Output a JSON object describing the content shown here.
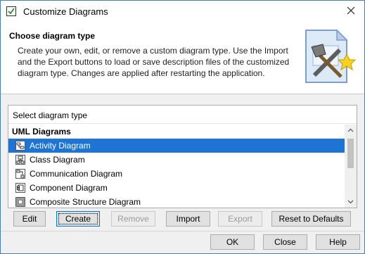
{
  "window": {
    "title": "Customize Diagrams"
  },
  "header": {
    "title": "Choose diagram type",
    "description": "Create your own, edit, or remove a custom diagram type. Use the Import and the Export buttons to load or save description files of the customized diagram type. Changes are applied after restarting the application."
  },
  "list": {
    "header": "Select diagram type",
    "group": "UML Diagrams",
    "items": [
      {
        "label": "Activity Diagram",
        "icon": "activity-diagram-icon",
        "selected": true
      },
      {
        "label": "Class Diagram",
        "icon": "class-diagram-icon",
        "selected": false
      },
      {
        "label": "Communication Diagram",
        "icon": "communication-diagram-icon",
        "selected": false
      },
      {
        "label": "Component Diagram",
        "icon": "component-diagram-icon",
        "selected": false
      },
      {
        "label": "Composite Structure Diagram",
        "icon": "composite-structure-diagram-icon",
        "selected": false
      }
    ]
  },
  "actions": {
    "edit": "Edit",
    "create": "Create",
    "remove": "Remove",
    "import": "Import",
    "export": "Export",
    "reset": "Reset to Defaults"
  },
  "footer": {
    "ok": "OK",
    "close": "Close",
    "help": "Help"
  },
  "colors": {
    "selection": "#1e74d4",
    "border": "#4a7fb5"
  }
}
